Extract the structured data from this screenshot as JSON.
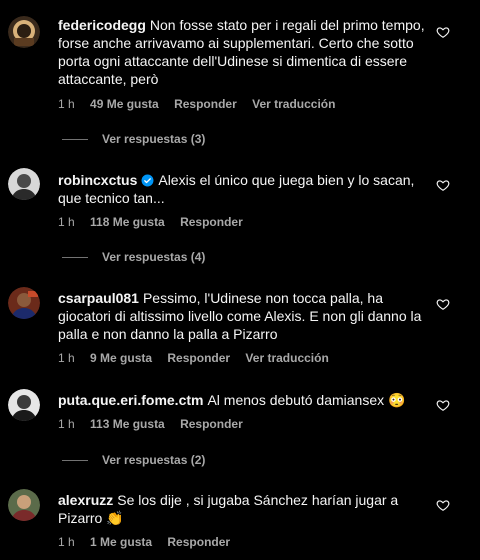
{
  "comments": [
    {
      "username": "federicodegg",
      "text": "Non fosse stato per i regali del primo tempo, forse anche arrivavamo ai supplementari. Certo che sotto porta ogni attaccante dell'Udinese si dimentica di essere attaccante, però",
      "time": "1 h",
      "likes": "49 Me gusta",
      "reply": "Responder",
      "translate": "Ver traducción",
      "view_replies": "Ver respuestas (3)"
    },
    {
      "username": "robincxctus",
      "verified": true,
      "text": "Alexis el único que juega bien y lo sacan, que tecnico tan...",
      "time": "1 h",
      "likes": "118 Me gusta",
      "reply": "Responder",
      "view_replies": "Ver respuestas (4)"
    },
    {
      "username": "csarpaul081",
      "text": "Pessimo, l'Udinese non tocca palla, ha giocatori di altissimo livello come Alexis. E non gli danno la palla e non danno la palla a Pizarro",
      "time": "1 h",
      "likes": "9 Me gusta",
      "reply": "Responder",
      "translate": "Ver traducción"
    },
    {
      "username": "puta.que.eri.fome.ctm",
      "text": "Al menos debutó damiansex 😳",
      "time": "1 h",
      "likes": "113 Me gusta",
      "reply": "Responder",
      "view_replies": "Ver respuestas (2)"
    },
    {
      "username": "alexruzz",
      "text": "Se los dije , si jugaba Sánchez harían jugar a Pizarro 👏",
      "time": "1 h",
      "likes": "1 Me gusta",
      "reply": "Responder"
    }
  ],
  "colors": {
    "background": "#000000",
    "text": "#f5f5f5",
    "muted": "#a8a8a8",
    "verified": "#0095f6"
  },
  "icons": {
    "like": "heart-outline-icon",
    "verified": "verified-badge-icon"
  }
}
